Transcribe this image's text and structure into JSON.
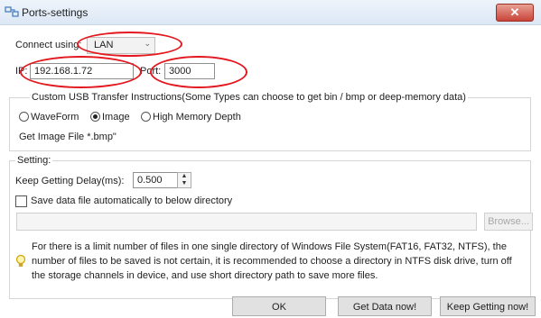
{
  "window": {
    "title": "Ports-settings",
    "close_label": "✕"
  },
  "connection": {
    "label": "Connect using:",
    "selected": "LAN",
    "ip_label": "IP:",
    "ip_value": "192.168.1.72",
    "port_label": "Port:",
    "port_value": "3000"
  },
  "custom": {
    "label": "Custom USB Transfer Instructions(Some Types can choose to get bin / bmp or deep-memory data)",
    "options": [
      "WaveForm",
      "Image",
      "High Memory Depth"
    ],
    "selected": "Image",
    "file_note": "Get Image File *.bmp\""
  },
  "setting": {
    "label": "Setting:",
    "delay_label": "Keep Getting Delay(ms):",
    "delay_value": "0.500",
    "save_label": "Save data file automatically to below directory",
    "directory_value": "",
    "browse_label": "Browse..."
  },
  "info": {
    "text": "For there is a limit number of files in one single directory of Windows File System(FAT16, FAT32, NTFS), the number of  files to be saved is not certain,  it is recommended to choose a directory in NTFS disk drive, turn off the storage channels in device, and use short directory path to save more files."
  },
  "buttons": {
    "ok": "OK",
    "get_data": "Get Data now!",
    "keep_getting": "Keep Getting now!"
  },
  "colors": {
    "annotation": "#e3171e",
    "titlebar": "#dce7f5",
    "close": "#c9443a"
  }
}
